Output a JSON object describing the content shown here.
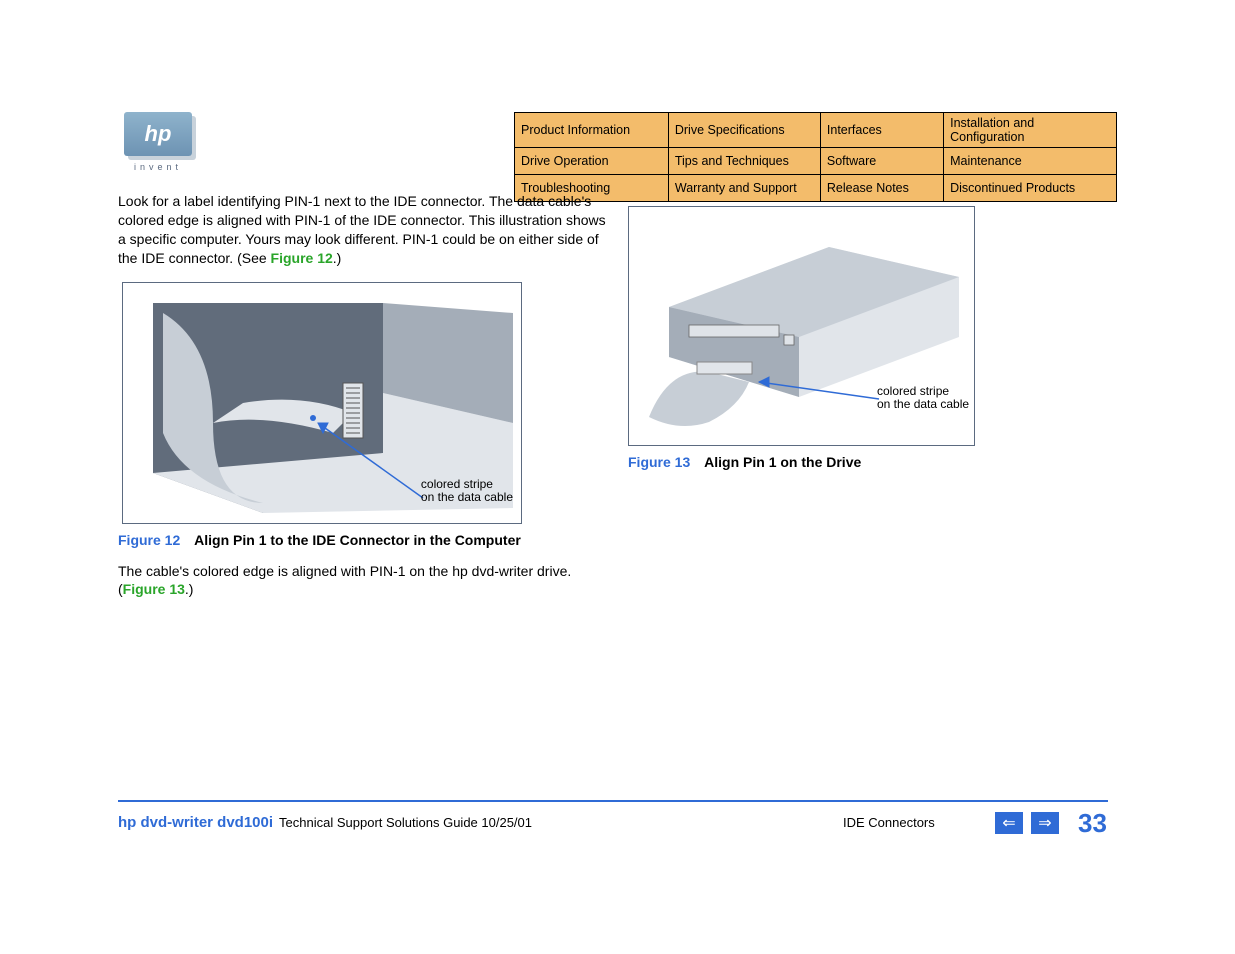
{
  "logo": {
    "text": "hp",
    "tagline": "invent"
  },
  "nav": {
    "rows": [
      [
        "Product Information",
        "Drive Specifications",
        "Interfaces",
        "Installation and Configuration"
      ],
      [
        "Drive Operation",
        "Tips and Techniques",
        "Software",
        "Maintenance"
      ],
      [
        "Troubleshooting",
        "Warranty and Support",
        "Release Notes",
        "Discontinued Products"
      ]
    ]
  },
  "body": {
    "para1_a": "Look for a label identifying PIN-1 next to the IDE connector. The data cable's colored edge is aligned with PIN-1 of the IDE connector. This illustration shows a specific computer. Yours may look different. PIN-1 could be on either side of the IDE connector. (See ",
    "para1_link": "Figure 12",
    "para1_b": ".)",
    "para2_a": "The cable's colored edge is aligned with PIN-1 on the hp dvd-writer drive. (",
    "para2_link": "Figure 13",
    "para2_b": ".)"
  },
  "figures": {
    "f12": {
      "num": "Figure 12",
      "caption": "Align Pin 1 to the IDE Connector in the Computer",
      "annot1": "colored stripe",
      "annot2": "on the data cable"
    },
    "f13": {
      "num": "Figure 13",
      "caption": "Align Pin 1 on the Drive",
      "annot1": "colored stripe",
      "annot2": "on the data cable"
    }
  },
  "footer": {
    "product": "hp dvd-writer  dvd100i",
    "guide": "Technical Support Solutions Guide 10/25/01",
    "section": "IDE Connectors",
    "page": "33"
  }
}
